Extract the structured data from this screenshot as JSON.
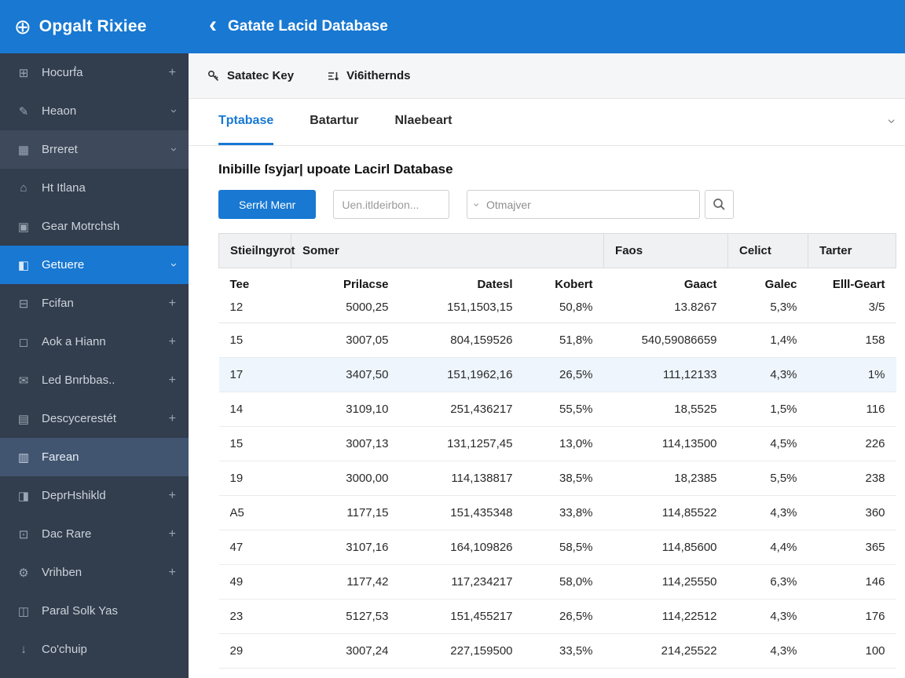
{
  "topbar": {
    "logo_text": "Opgalt Rixiee",
    "back_glyph": "‹",
    "title": "Gatate Lacid Database"
  },
  "sidebar": {
    "items": [
      {
        "label": "Hocurḟa",
        "icon": "grid-icon",
        "trailing": "plus"
      },
      {
        "label": "Heaon",
        "icon": "edit-icon",
        "trailing": "chevron"
      },
      {
        "label": "Brreret",
        "icon": "table-icon",
        "trailing": "chevron",
        "variant": "subtle"
      },
      {
        "label": "Ht Itlana",
        "icon": "home-icon",
        "trailing": ""
      },
      {
        "label": "Gear Motrchsh",
        "icon": "layers-icon",
        "trailing": ""
      },
      {
        "label": "Getuere",
        "icon": "folder-icon",
        "trailing": "chevron",
        "variant": "active"
      },
      {
        "label": "Fcifan",
        "icon": "panel-icon",
        "trailing": "plus"
      },
      {
        "label": "Aok a Hiann",
        "icon": "window-icon",
        "trailing": "plus"
      },
      {
        "label": "Led Bnrbbas..",
        "icon": "mail-icon",
        "trailing": "plus"
      },
      {
        "label": "Descycerestét",
        "icon": "list-icon",
        "trailing": "plus"
      },
      {
        "label": "Farean",
        "icon": "bars-icon",
        "trailing": "",
        "variant": "active2"
      },
      {
        "label": "DeprHshikld",
        "icon": "split-icon",
        "trailing": "plus"
      },
      {
        "label": "Dac Rare",
        "icon": "box-icon",
        "trailing": "plus"
      },
      {
        "label": "Vrihben",
        "icon": "gear-icon",
        "trailing": "plus"
      },
      {
        "label": "Paral Solk Yas",
        "icon": "modules-icon",
        "trailing": ""
      },
      {
        "label": "Co'chuip",
        "icon": "download-icon",
        "trailing": ""
      }
    ]
  },
  "toolbar": {
    "actions": [
      {
        "icon": "key-icon",
        "label": "Satatec Key"
      },
      {
        "icon": "filter-icon",
        "label": "Vi6ithernds"
      }
    ]
  },
  "tabs": {
    "items": [
      {
        "label": "Tptabase",
        "active": true
      },
      {
        "label": "Batartur",
        "active": false
      },
      {
        "label": "Nlaebeart",
        "active": false
      }
    ]
  },
  "content": {
    "section_title": "Inibille ſsyjar| upoate Lacirl Database",
    "primary_button": "Serrkl Menr",
    "search_placeholder": "Uen.itldeirbon...",
    "dropdown_value": "Otmajver"
  },
  "table": {
    "groups": [
      {
        "label": "Stieilngyrot",
        "span": 1
      },
      {
        "label": "Somer",
        "span": 3
      },
      {
        "label": "Faos",
        "span": 1
      },
      {
        "label": "Celict",
        "span": 1
      },
      {
        "label": "Tarter",
        "span": 1
      }
    ],
    "columns": [
      "Tee",
      "Prilacse",
      "Datesl",
      "Kobert",
      "Gaact",
      "Galec",
      "Elll-Geart"
    ],
    "rows": [
      {
        "cells": [
          {
            "v": "12"
          },
          {
            "v": "5000,25",
            "c": "blue"
          },
          {
            "v": "151,1503,15"
          },
          {
            "v": "50,8%",
            "c": "red"
          },
          {
            "v": "13.8267",
            "c": "red"
          },
          {
            "v": "5,3%",
            "c": "red"
          },
          {
            "v": "3/5"
          }
        ]
      },
      {
        "cells": [
          {
            "v": "15"
          },
          {
            "v": "3007,05"
          },
          {
            "v": "804,159526"
          },
          {
            "v": "51,8%",
            "c": "red"
          },
          {
            "v": "540,59086659"
          },
          {
            "v": "1,4%"
          },
          {
            "v": "158",
            "c": "blue"
          }
        ]
      },
      {
        "cells": [
          {
            "v": "17"
          },
          {
            "v": "3407,50"
          },
          {
            "v": "151,1962,16"
          },
          {
            "v": "26,5%"
          },
          {
            "v": "111,12133"
          },
          {
            "v": "4,3%"
          },
          {
            "v": "1%",
            "c": "blue"
          }
        ],
        "highlight": true
      },
      {
        "cells": [
          {
            "v": "14"
          },
          {
            "v": "3109,10"
          },
          {
            "v": "251,436217"
          },
          {
            "v": "55,5%"
          },
          {
            "v": "18,5525"
          },
          {
            "v": "1,5%"
          },
          {
            "v": "116",
            "c": "blue"
          }
        ]
      },
      {
        "cells": [
          {
            "v": "15"
          },
          {
            "v": "3007,13"
          },
          {
            "v": "131,1257,45"
          },
          {
            "v": "13,0%"
          },
          {
            "v": "114,13500"
          },
          {
            "v": "4,5%"
          },
          {
            "v": "226",
            "c": "blue"
          }
        ]
      },
      {
        "cells": [
          {
            "v": "19"
          },
          {
            "v": "3000,00"
          },
          {
            "v": "114,138817"
          },
          {
            "v": "38,5%"
          },
          {
            "v": "18,2385"
          },
          {
            "v": "5,5%"
          },
          {
            "v": "238",
            "c": "blue"
          }
        ]
      },
      {
        "cells": [
          {
            "v": "A5"
          },
          {
            "v": "1177,15"
          },
          {
            "v": "151,435348"
          },
          {
            "v": "33,8%"
          },
          {
            "v": "114,85522"
          },
          {
            "v": "4,3%"
          },
          {
            "v": "360",
            "c": "blue"
          }
        ]
      },
      {
        "cells": [
          {
            "v": "47"
          },
          {
            "v": "3107,16"
          },
          {
            "v": "164,109826"
          },
          {
            "v": "58,5%"
          },
          {
            "v": "114,85600"
          },
          {
            "v": "4,4%"
          },
          {
            "v": "365",
            "c": "blue"
          }
        ]
      },
      {
        "cells": [
          {
            "v": "49"
          },
          {
            "v": "1177,42"
          },
          {
            "v": "117,234217"
          },
          {
            "v": "58,0%"
          },
          {
            "v": "114,25550"
          },
          {
            "v": "6,3%"
          },
          {
            "v": "146",
            "c": "blue"
          }
        ]
      },
      {
        "cells": [
          {
            "v": "23"
          },
          {
            "v": "5127,53"
          },
          {
            "v": "151,455217"
          },
          {
            "v": "26,5%"
          },
          {
            "v": "114,22512"
          },
          {
            "v": "4,3%"
          },
          {
            "v": "176",
            "c": "blue"
          }
        ]
      },
      {
        "cells": [
          {
            "v": "29"
          },
          {
            "v": "3007,24"
          },
          {
            "v": "227,159500"
          },
          {
            "v": "33,5%"
          },
          {
            "v": "214,25522"
          },
          {
            "v": "4,3%"
          },
          {
            "v": "100",
            "c": "blue"
          }
        ]
      }
    ]
  }
}
